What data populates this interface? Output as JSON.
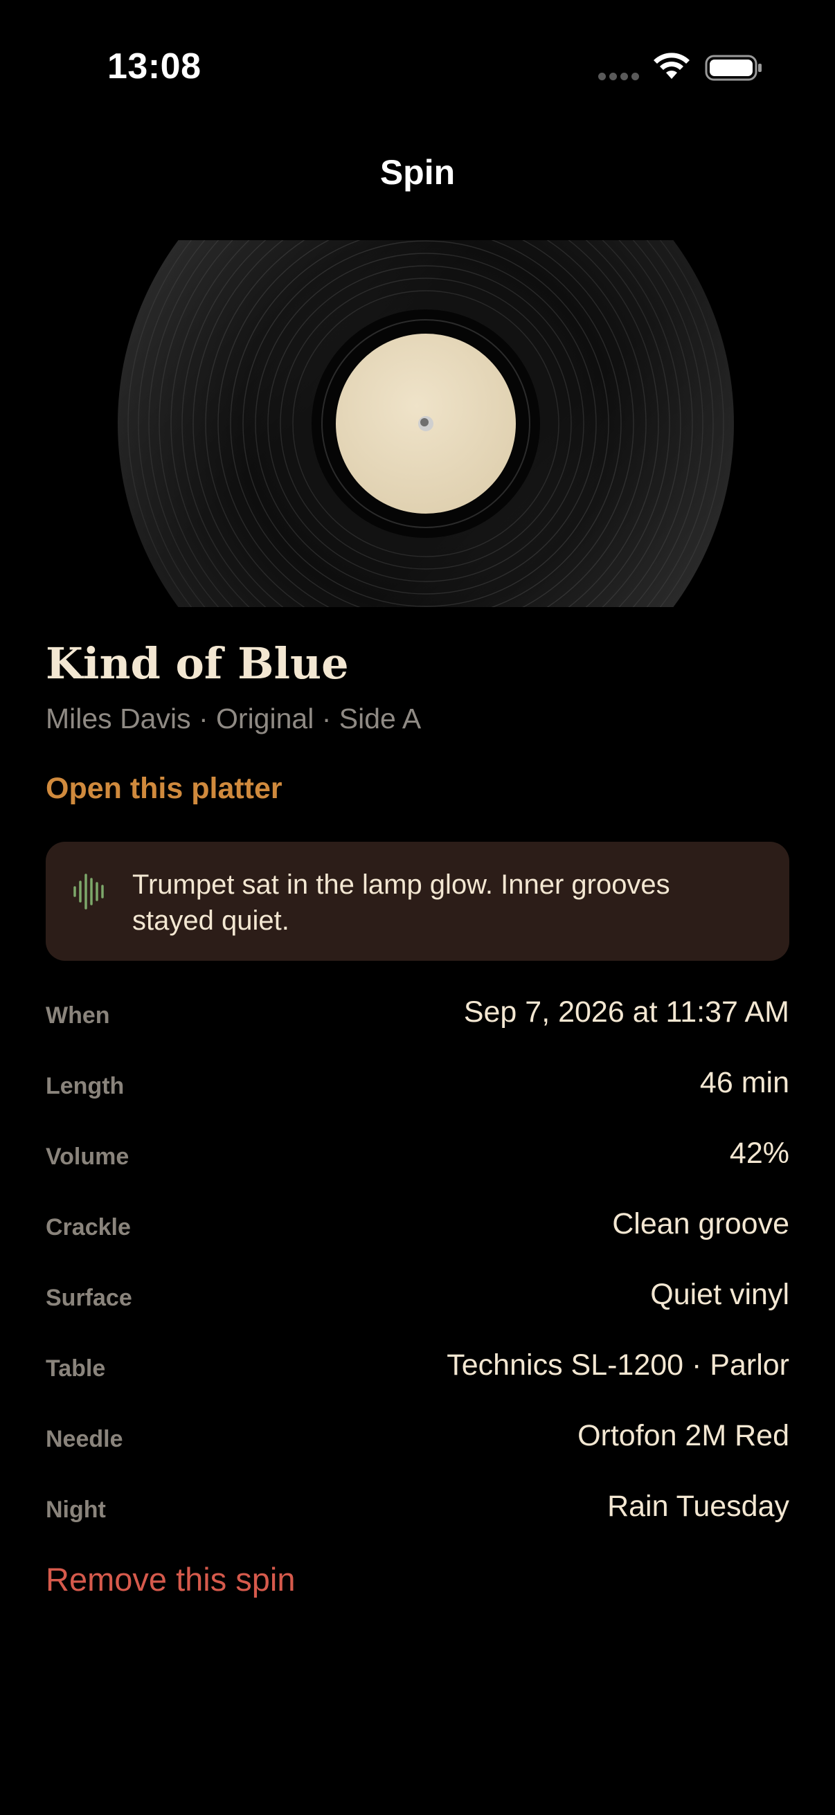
{
  "status_bar": {
    "time": "13:08",
    "icons": [
      "cellular-signal-icon",
      "wifi-icon",
      "battery-icon"
    ]
  },
  "nav": {
    "title": "Spin"
  },
  "record": {
    "image": "vinyl-record-artwork",
    "colors": {
      "vinyl": "#0c0c0c",
      "label": "#eaddc3"
    }
  },
  "album": {
    "title": "Kind of Blue",
    "subtitle": "Miles Davis · Original · Side A",
    "open_link": "Open this platter"
  },
  "note": {
    "icon": "waveform-icon",
    "text": "Trumpet sat in the lamp glow. Inner grooves stayed quiet."
  },
  "details": [
    {
      "label": "When",
      "value": "Sep 7, 2026 at 11:37 AM"
    },
    {
      "label": "Length",
      "value": "46 min"
    },
    {
      "label": "Volume",
      "value": "42%"
    },
    {
      "label": "Crackle",
      "value": "Clean groove"
    },
    {
      "label": "Surface",
      "value": "Quiet vinyl"
    },
    {
      "label": "Table",
      "value": "Technics SL-1200 · Parlor"
    },
    {
      "label": "Needle",
      "value": "Ortofon 2M Red"
    },
    {
      "label": "Night",
      "value": "Rain Tuesday"
    }
  ],
  "actions": {
    "remove": "Remove this spin"
  },
  "colors": {
    "background": "#000000",
    "accent": "#d08a3d",
    "destructive": "#d65a4c",
    "card": "#2c1d18",
    "waveform": "#7da86a"
  }
}
